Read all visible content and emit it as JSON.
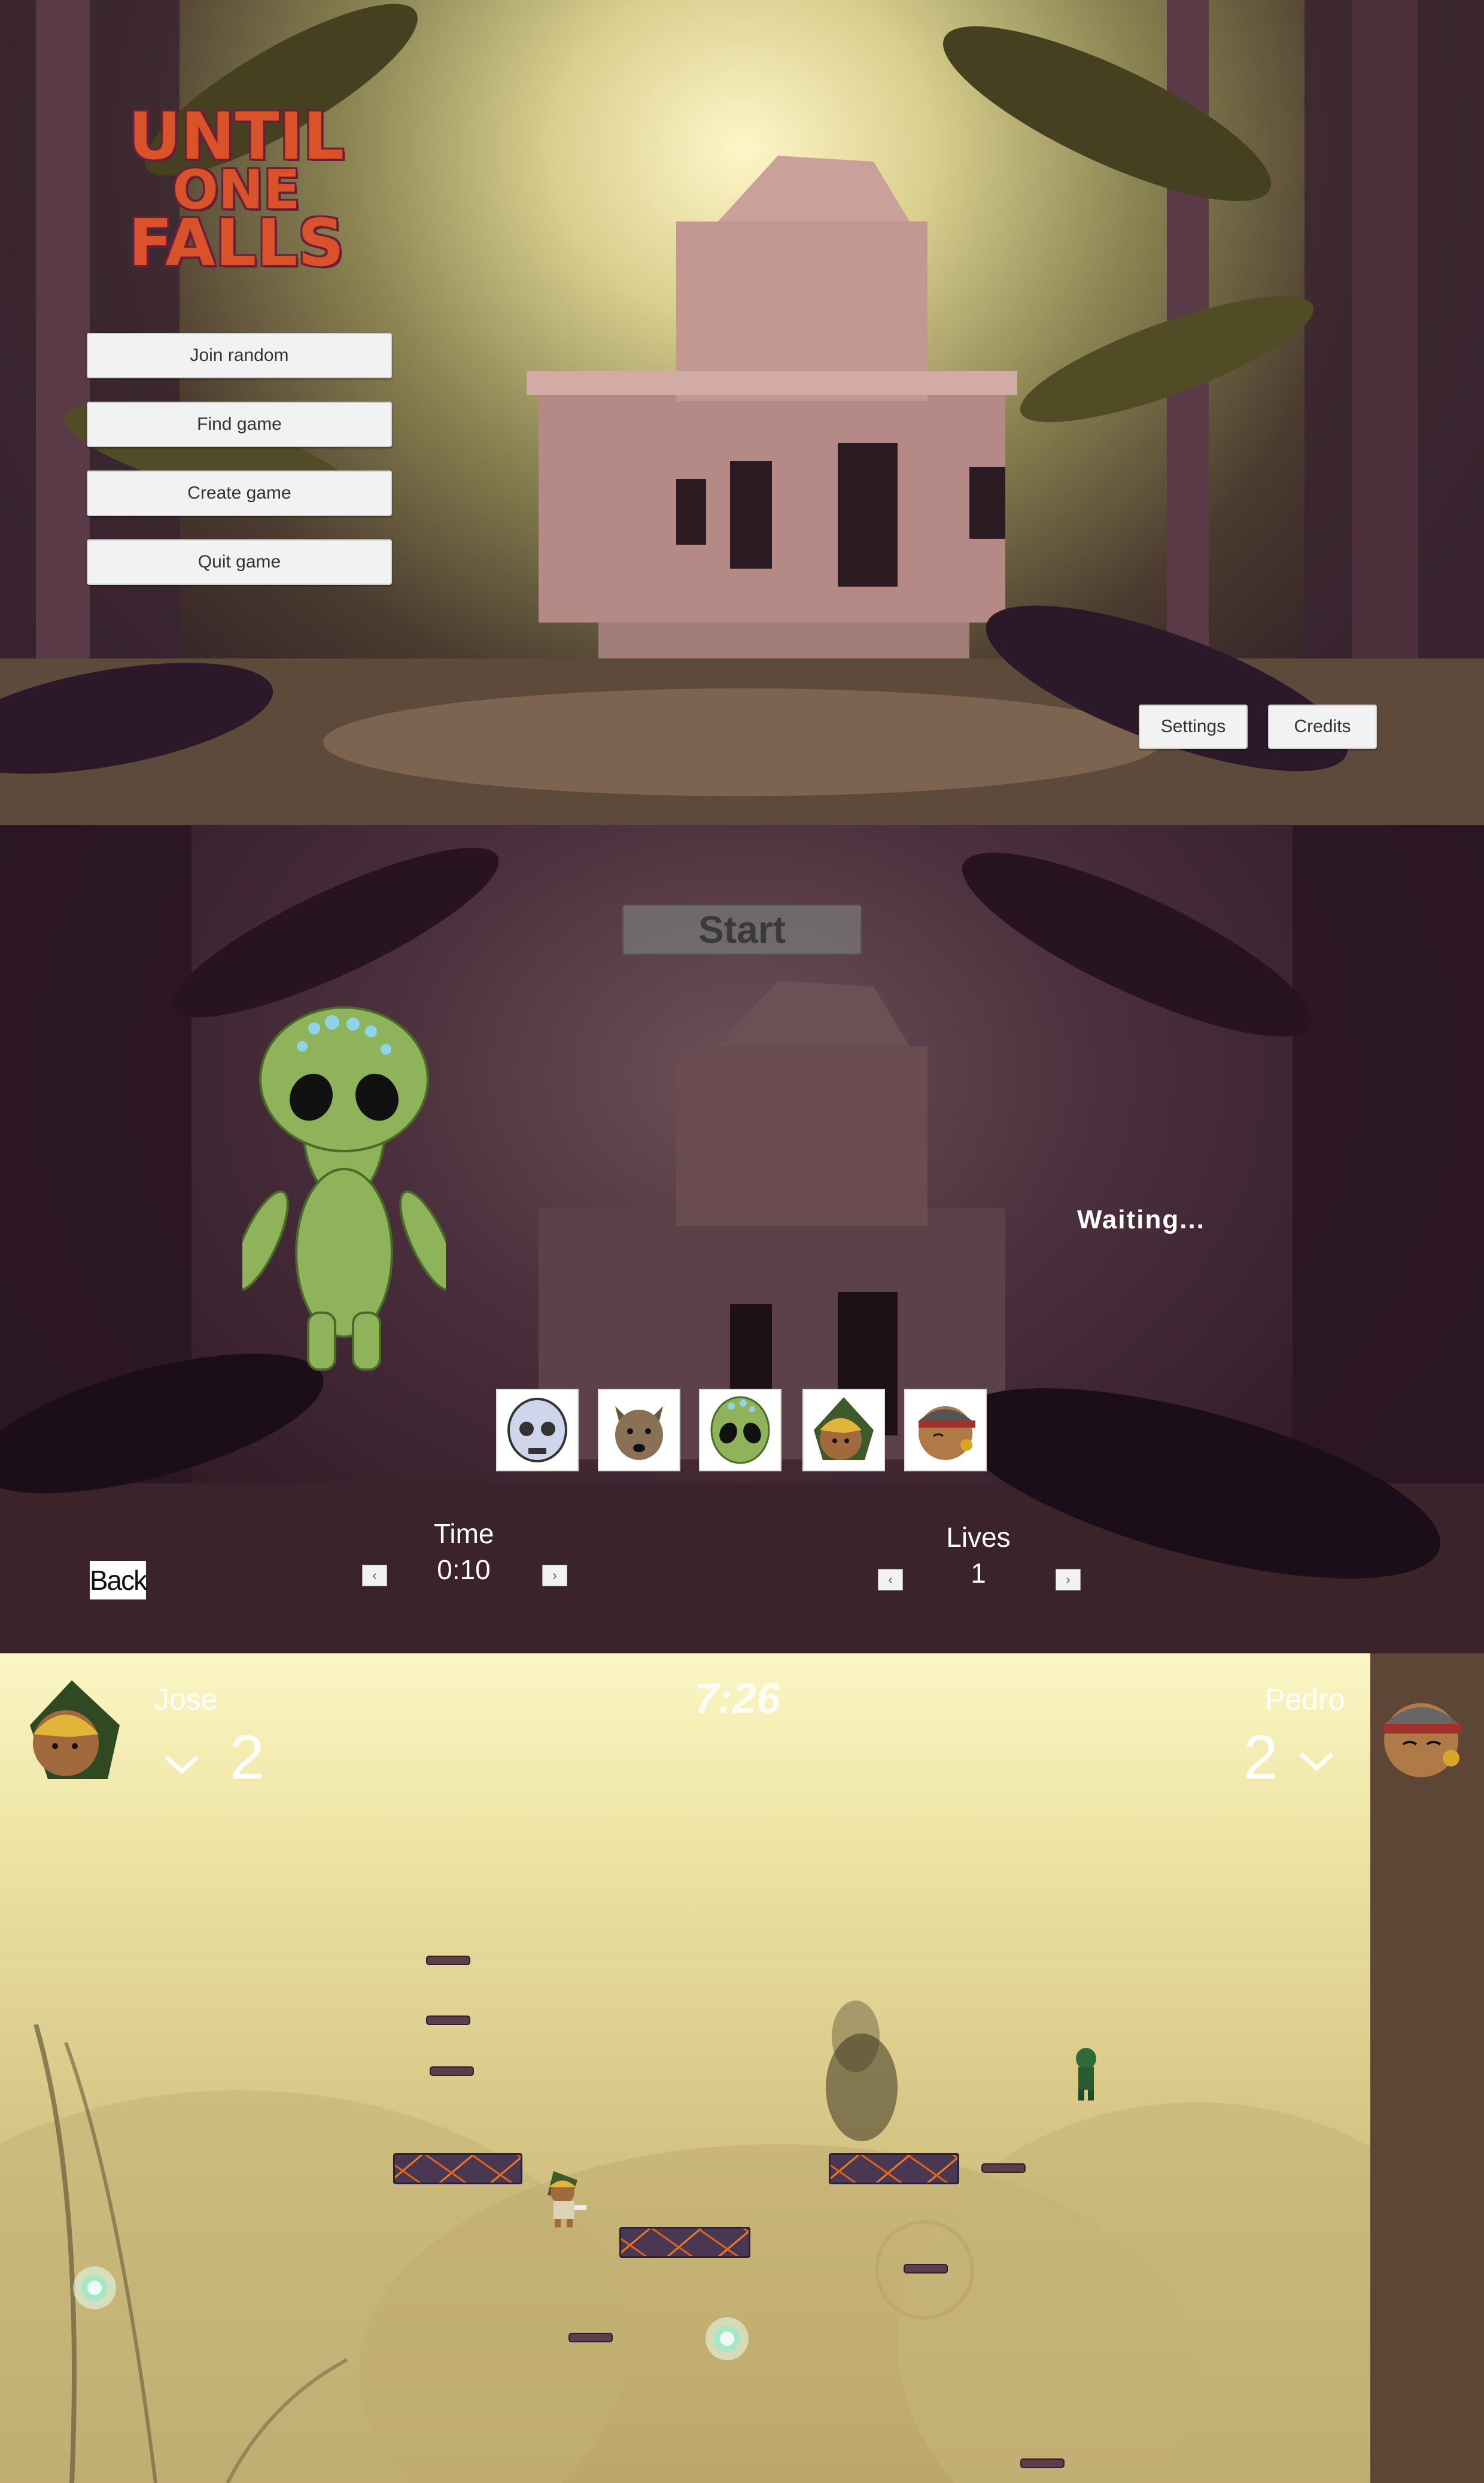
{
  "menu": {
    "logo_line1": "UNTIL",
    "logo_line2": "ONE",
    "logo_line3": "FALLS",
    "buttons": [
      "Join random",
      "Find game",
      "Create game",
      "Quit game"
    ],
    "settings_label": "Settings",
    "credits_label": "Credits"
  },
  "lobby": {
    "start_label": "Start",
    "status": "Waiting...",
    "selected_character": "alien",
    "characters": [
      "skull",
      "dog",
      "alien",
      "aztec-warrior",
      "headband-warrior"
    ],
    "time_label": "Time",
    "time_value": "0:10",
    "lives_label": "Lives",
    "lives_value": "1",
    "back_label": "Back",
    "arrow_left": "‹",
    "arrow_right": "›"
  },
  "game": {
    "timer": "7:26",
    "player1": {
      "name": "Jose",
      "lives": "2",
      "character": "aztec-warrior",
      "indicator": "chevron-down"
    },
    "player2": {
      "name": "Pedro",
      "lives": "2",
      "character": "headband-warrior",
      "indicator": "chevron-down"
    }
  },
  "colors": {
    "logo": "#d9522a",
    "alien": "#8fb35a",
    "lava": "#e3621c",
    "sidebar": "#5e4636"
  }
}
